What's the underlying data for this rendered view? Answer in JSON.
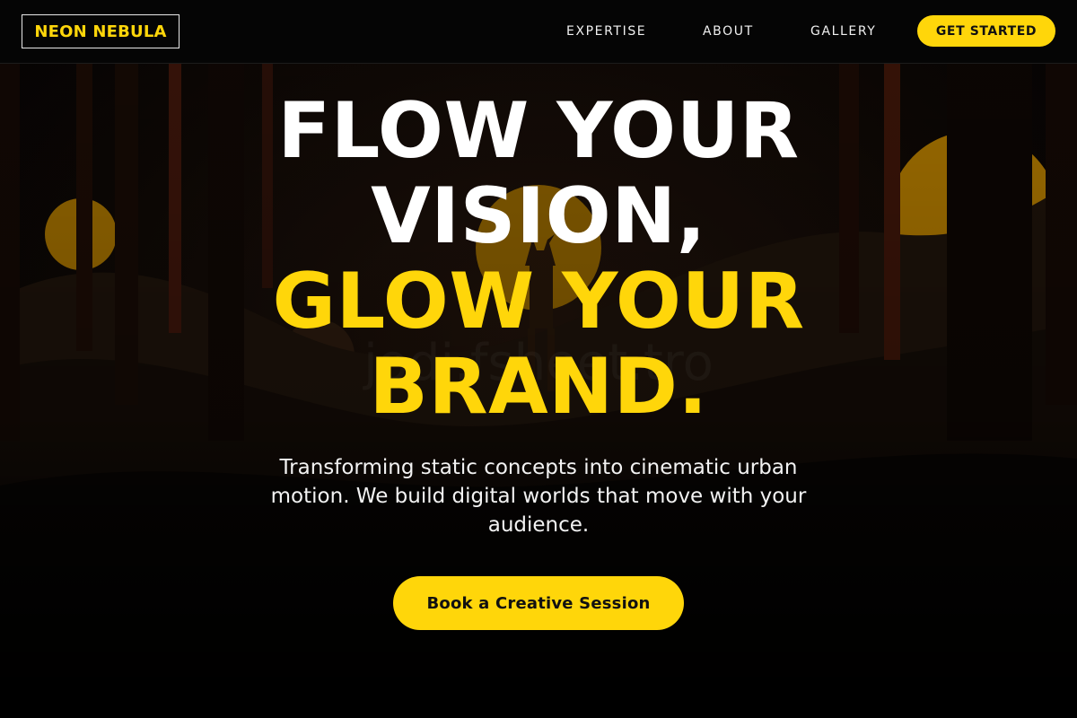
{
  "header": {
    "logo": "NEON NEBULA",
    "nav": [
      "EXPERTISE",
      "ABOUT",
      "GALLERY"
    ],
    "cta_label": "GET STARTED"
  },
  "hero": {
    "headline_line1": "FLOW YOUR",
    "headline_line2": "VISION,",
    "headline_line3": "GLOW YOUR",
    "headline_line4": "BRAND.",
    "tagline": "Transforming static concepts into cinematic urban motion. We build digital worlds that move with your audience.",
    "cta_label": "Book a Creative Session"
  },
  "colors": {
    "accent": "#ffd60a",
    "background": "#000000",
    "text": "#ffffff"
  }
}
